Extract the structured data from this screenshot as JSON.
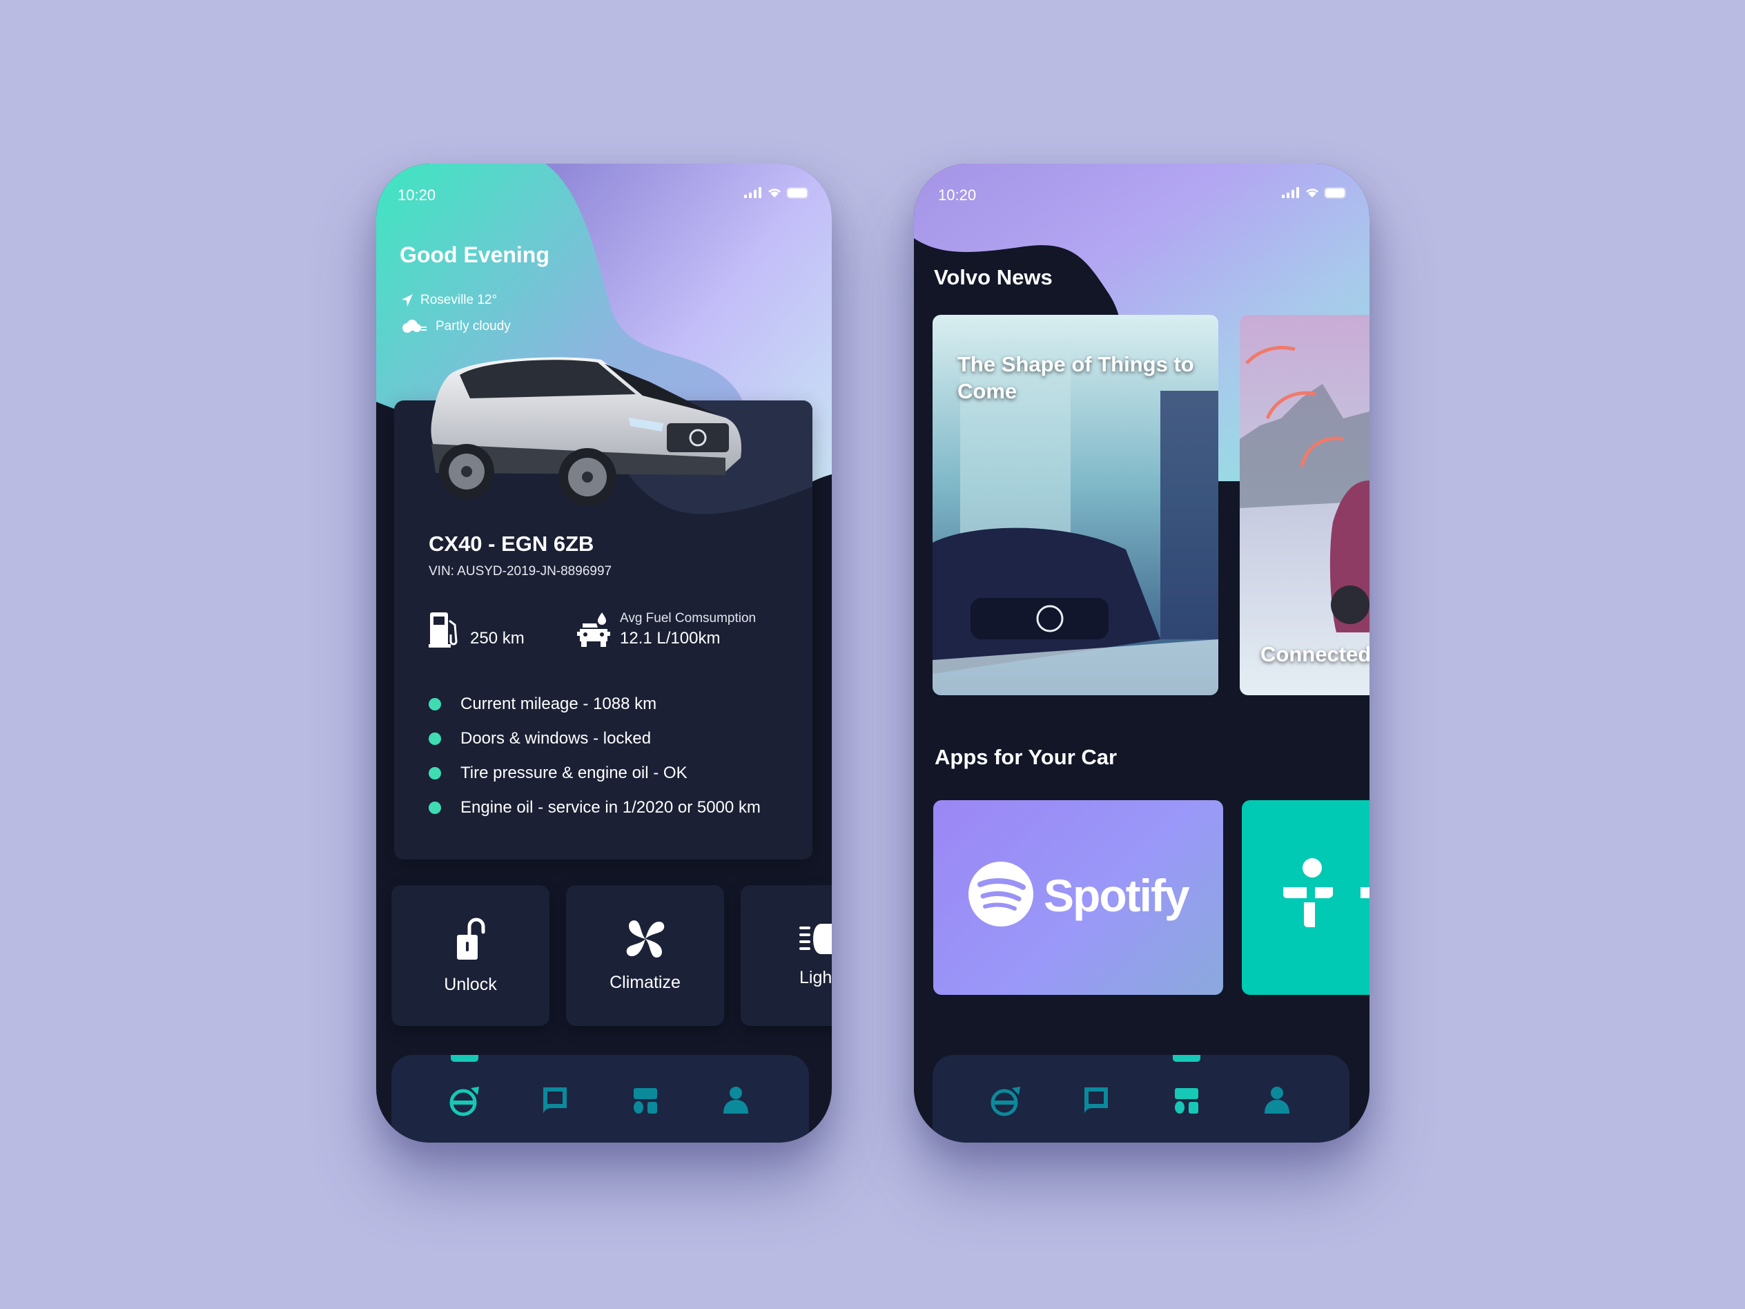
{
  "colors": {
    "page_bg": "#b9bbe3",
    "phone_bg": "#121627",
    "card_bg": "#1b2034",
    "accent_teal": "#16c8b6",
    "bullet_green": "#3fdcb4",
    "nav_icon": "#0b8a9c",
    "tunein_bg": "#00c9b4"
  },
  "home": {
    "status": {
      "time": "10:20"
    },
    "greeting": "Good Evening",
    "weather": {
      "location": "Roseville 12°",
      "location_icon": "location-arrow-icon",
      "condition": "Partly cloudy",
      "condition_icon": "partly-cloudy-icon"
    },
    "car": {
      "title": "CX40 - EGN 6ZB",
      "vin": "VIN: AUSYD-2019-JN-8896997",
      "range": {
        "icon": "fuel-pump-icon",
        "value": "250 km"
      },
      "consumption": {
        "icon": "car-fuel-icon",
        "label": "Avg Fuel Comsumption",
        "value": "12.1 L/100km"
      },
      "status_items": [
        "Current mileage - 1088 km",
        "Doors & windows - locked",
        "Tire pressure & engine oil - OK",
        "Engine oil - service in 1/2020 or 5000 km"
      ]
    },
    "actions": [
      {
        "label": "Unlock",
        "icon": "unlock-icon"
      },
      {
        "label": "Climatize",
        "icon": "fan-icon"
      },
      {
        "label": "Lights",
        "icon": "headlight-icon"
      }
    ],
    "nav": {
      "active": "car",
      "items": [
        {
          "id": "car",
          "icon": "volvo-logo-icon"
        },
        {
          "id": "messages",
          "icon": "chat-icon"
        },
        {
          "id": "discover",
          "icon": "dashboard-icon"
        },
        {
          "id": "profile",
          "icon": "person-icon"
        }
      ]
    }
  },
  "discover": {
    "status": {
      "time": "10:20"
    },
    "news_title": "Volvo News",
    "news": [
      {
        "title": "The Shape of Things to Come"
      },
      {
        "title": "Connected"
      }
    ],
    "apps_title": "Apps for Your Car",
    "apps": [
      {
        "name": "Spotify",
        "icon": "spotify-logo-icon"
      },
      {
        "name": "TuneIn",
        "icon": "tunein-logo-icon"
      }
    ],
    "nav": {
      "active": "discover",
      "items": [
        {
          "id": "car",
          "icon": "volvo-logo-icon"
        },
        {
          "id": "messages",
          "icon": "chat-icon"
        },
        {
          "id": "discover",
          "icon": "dashboard-icon"
        },
        {
          "id": "profile",
          "icon": "person-icon"
        }
      ]
    }
  }
}
